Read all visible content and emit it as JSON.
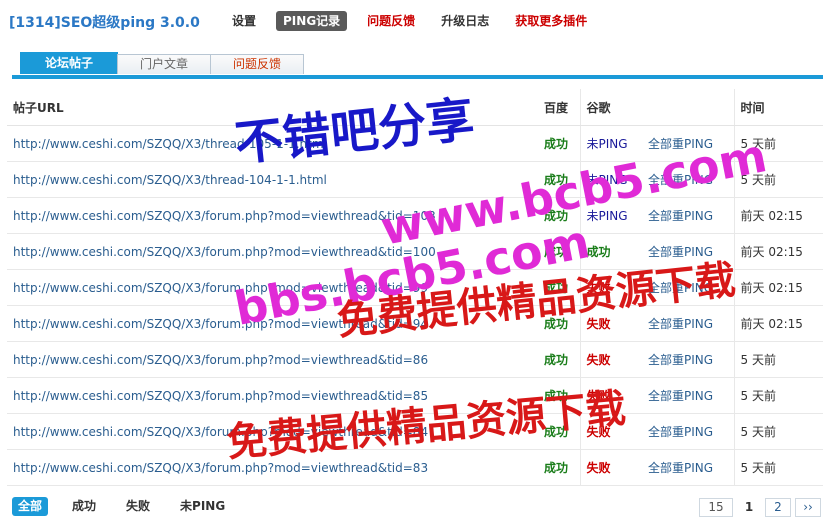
{
  "header": {
    "app_title": "[1314]SEO超级ping 3.0.0",
    "nav": [
      {
        "label": "设置",
        "style": "plain"
      },
      {
        "label": "PING记录",
        "style": "active"
      },
      {
        "label": "问题反馈",
        "style": "red"
      },
      {
        "label": "升级日志",
        "style": "plain"
      },
      {
        "label": "获取更多插件",
        "style": "red"
      }
    ]
  },
  "tabs": [
    {
      "label": "论坛帖子",
      "style": "active"
    },
    {
      "label": "门户文章",
      "style": "gray"
    },
    {
      "label": "问题反馈",
      "style": "red"
    }
  ],
  "table": {
    "columns": [
      "帖子URL",
      "百度",
      "谷歌",
      "",
      "时间"
    ],
    "rows": [
      {
        "url": "http://www.ceshi.com/SZQQ/X3/thread-105-1-1.html",
        "baidu": "成功",
        "google": "未PING",
        "action": "全部重PING",
        "time": "5 天前"
      },
      {
        "url": "http://www.ceshi.com/SZQQ/X3/thread-104-1-1.html",
        "baidu": "成功",
        "google": "未PING",
        "action": "全部重PING",
        "time": "5 天前"
      },
      {
        "url": "http://www.ceshi.com/SZQQ/X3/forum.php?mod=viewthread&tid=103",
        "baidu": "成功",
        "google": "未PING",
        "action": "全部重PING",
        "time": "前天 02:15"
      },
      {
        "url": "http://www.ceshi.com/SZQQ/X3/forum.php?mod=viewthread&tid=100",
        "baidu": "成功",
        "google": "成功",
        "action": "全部重PING",
        "time": "前天 02:15"
      },
      {
        "url": "http://www.ceshi.com/SZQQ/X3/forum.php?mod=viewthread&tid=99",
        "baidu": "成功",
        "google": "失败",
        "action": "全部重PING",
        "time": "前天 02:15"
      },
      {
        "url": "http://www.ceshi.com/SZQQ/X3/forum.php?mod=viewthread&tid=94",
        "baidu": "成功",
        "google": "失败",
        "action": "全部重PING",
        "time": "前天 02:15"
      },
      {
        "url": "http://www.ceshi.com/SZQQ/X3/forum.php?mod=viewthread&tid=86",
        "baidu": "成功",
        "google": "失败",
        "action": "全部重PING",
        "time": "5 天前"
      },
      {
        "url": "http://www.ceshi.com/SZQQ/X3/forum.php?mod=viewthread&tid=85",
        "baidu": "成功",
        "google": "失败",
        "action": "全部重PING",
        "time": "5 天前"
      },
      {
        "url": "http://www.ceshi.com/SZQQ/X3/forum.php?mod=viewthread&tid=84",
        "baidu": "成功",
        "google": "失败",
        "action": "全部重PING",
        "time": "5 天前"
      },
      {
        "url": "http://www.ceshi.com/SZQQ/X3/forum.php?mod=viewthread&tid=83",
        "baidu": "成功",
        "google": "失败",
        "action": "全部重PING",
        "time": "5 天前"
      }
    ]
  },
  "filters": [
    {
      "label": "全部",
      "active": true
    },
    {
      "label": "成功",
      "active": false
    },
    {
      "label": "失败",
      "active": false
    },
    {
      "label": "未PING",
      "active": false
    }
  ],
  "pager": {
    "total": "15",
    "current": "1",
    "pages": [
      "2"
    ],
    "next": "››"
  },
  "watermark": {
    "line1": "不错吧分享",
    "line2": "www.bcb5.com",
    "line3": "bbs.bcb5.com",
    "line4": "免费提供精品资源下载",
    "line5": "免费提供精品资源下载"
  },
  "colors": {
    "accent": "#1b9ad8",
    "success": "#1a7d1a",
    "fail": "#cc0000",
    "link": "#2a5d8f"
  }
}
